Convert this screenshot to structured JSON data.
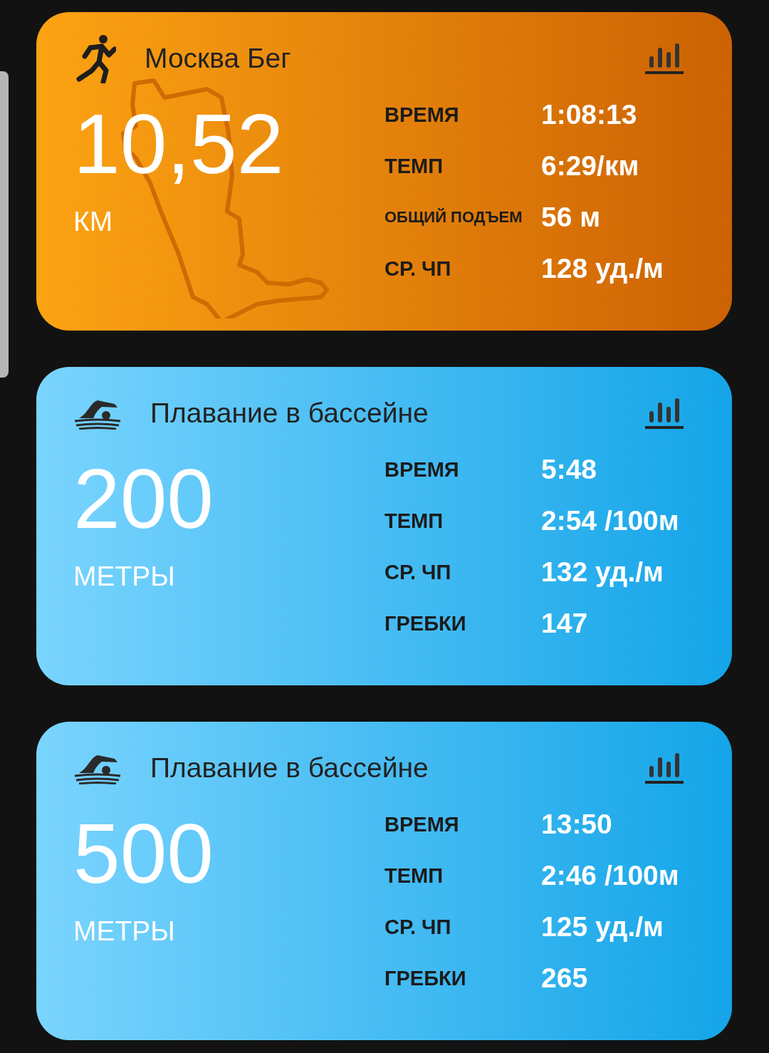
{
  "cards": [
    {
      "kind": "run",
      "title": "Москва Бег",
      "distance": "10,52",
      "unit": "КМ",
      "stats": [
        {
          "label": "ВРЕМЯ",
          "value": "1:08:13"
        },
        {
          "label": "ТЕМП",
          "value": "6:29/км"
        },
        {
          "label": "ОБЩИЙ ПОДЪЕМ",
          "value": "56 м"
        },
        {
          "label": "СР. ЧП",
          "value": "128 уд./м"
        }
      ]
    },
    {
      "kind": "swim",
      "title": "Плавание в бассейне",
      "distance": "200",
      "unit": "МЕТРЫ",
      "stats": [
        {
          "label": "ВРЕМЯ",
          "value": "5:48"
        },
        {
          "label": "ТЕМП",
          "value": "2:54 /100м"
        },
        {
          "label": "СР. ЧП",
          "value": "132 уд./м"
        },
        {
          "label": "ГРЕБКИ",
          "value": "147"
        }
      ]
    },
    {
      "kind": "swim",
      "title": "Плавание в бассейне",
      "distance": "500",
      "unit": "МЕТРЫ",
      "stats": [
        {
          "label": "ВРЕМЯ",
          "value": "13:50"
        },
        {
          "label": "ТЕМП",
          "value": "2:46 /100м"
        },
        {
          "label": "СР. ЧП",
          "value": "125 уд./м"
        },
        {
          "label": "ГРЕБКИ",
          "value": "265"
        }
      ]
    }
  ]
}
